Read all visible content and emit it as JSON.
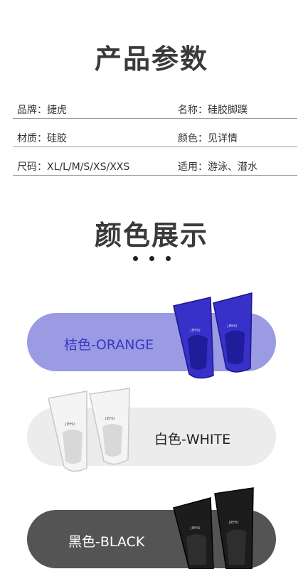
{
  "sections": {
    "params_title": "产品参数",
    "colors_title": "颜色展示"
  },
  "specs": [
    {
      "left": "品牌：捷虎",
      "right": "名称：硅胶脚蹼"
    },
    {
      "left": "材质：硅胶",
      "right": "颜色：见详情"
    },
    {
      "left": "尺码：XL/L/M/S/XS/XXS",
      "right": "适用：游泳、潜水"
    }
  ],
  "variants": [
    {
      "label": "桔色-ORANGE",
      "color": "#3730c9",
      "pill": "#9a9be2"
    },
    {
      "label": "白色-WHITE",
      "color": "#f4f4f4",
      "pill": "#ececec"
    },
    {
      "label": "黑色-BLACK",
      "color": "#1c1c1c",
      "pill": "#545454"
    }
  ]
}
